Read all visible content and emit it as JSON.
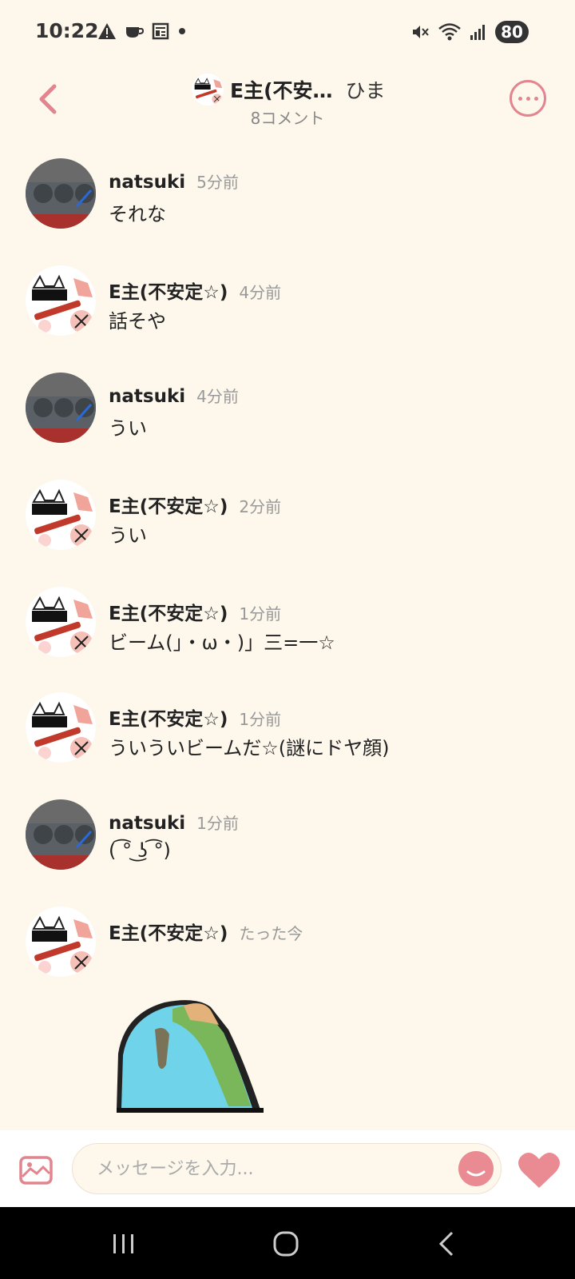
{
  "status_bar": {
    "time": "10:22",
    "battery": "80",
    "left_icons": [
      "warning-icon",
      "coffee-icon",
      "news-icon",
      "dot-icon"
    ],
    "right_icons": [
      "mute-icon",
      "wifi-icon",
      "signal-icon",
      "battery-icon"
    ]
  },
  "header": {
    "title": "E主(不安…",
    "topic": "ひま",
    "comment_count": "8コメント"
  },
  "messages": [
    {
      "user": "natsuki",
      "time": "5分前",
      "text": "それな",
      "avatar": "natsuki"
    },
    {
      "user": "E主(不安定☆)",
      "time": "4分前",
      "text": "話そや",
      "avatar": "e"
    },
    {
      "user": "natsuki",
      "time": "4分前",
      "text": "うい",
      "avatar": "natsuki"
    },
    {
      "user": "E主(不安定☆)",
      "time": "2分前",
      "text": "うい",
      "avatar": "e"
    },
    {
      "user": "E主(不安定☆)",
      "time": "1分前",
      "text": "ビーム(」・ω・)」三=一☆",
      "avatar": "e"
    },
    {
      "user": "E主(不安定☆)",
      "time": "1分前",
      "text": "ういういビームだ☆(謎にドヤ顔)",
      "avatar": "e"
    },
    {
      "user": "natsuki",
      "time": "1分前",
      "text": "( ͡° ͜ʖ ͡°)",
      "avatar": "natsuki"
    },
    {
      "user": "E主(不安定☆)",
      "time": "たった今",
      "text": "",
      "avatar": "e"
    }
  ],
  "input": {
    "placeholder": "メッセージを入力..."
  },
  "colors": {
    "background": "#fdf7ec",
    "accent": "#e2858f",
    "heart": "#ea8a92"
  }
}
